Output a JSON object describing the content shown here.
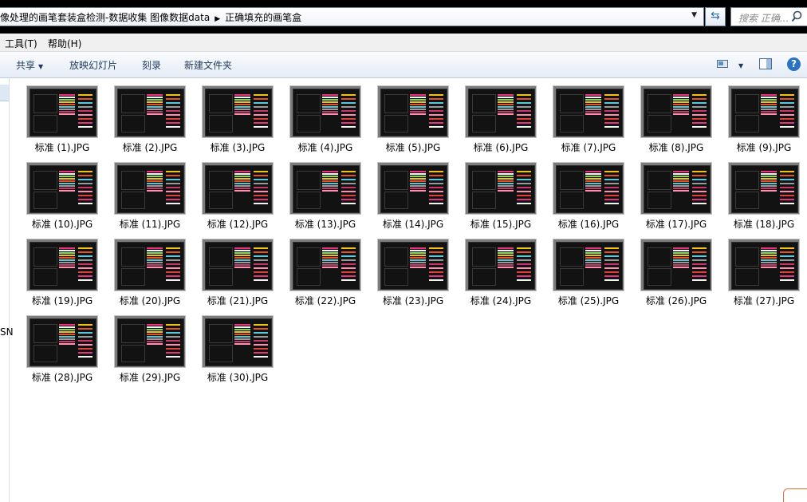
{
  "address": {
    "path_prefix": "像处理的画笔套装盒检测-数据收集 图像数据data",
    "path_current": "正确填充的画笔盒"
  },
  "search": {
    "placeholder": "搜索 正确..."
  },
  "menu": {
    "tools": "工具(T)",
    "help": "帮助(H)"
  },
  "toolbar": {
    "share": "共享",
    "slideshow": "放映幻灯片",
    "burn": "刻录",
    "new_folder": "新建文件夹",
    "help_label": "?"
  },
  "nav": {
    "clipped_text": "SN"
  },
  "colors": {
    "accent": "#2b73c2",
    "cmd_text": "#1e395b"
  },
  "files": [
    "标准 (1).JPG",
    "标准 (2).JPG",
    "标准 (3).JPG",
    "标准 (4).JPG",
    "标准 (5).JPG",
    "标准 (6).JPG",
    "标准 (7).JPG",
    "标准 (8).JPG",
    "标准 (9).JPG",
    "标准 (10).JPG",
    "标准 (11).JPG",
    "标准 (12).JPG",
    "标准 (13).JPG",
    "标准 (14).JPG",
    "标准 (15).JPG",
    "标准 (16).JPG",
    "标准 (17).JPG",
    "标准 (18).JPG",
    "标准 (19).JPG",
    "标准 (20).JPG",
    "标准 (21).JPG",
    "标准 (22).JPG",
    "标准 (23).JPG",
    "标准 (24).JPG",
    "标准 (25).JPG",
    "标准 (26).JPG",
    "标准 (27).JPG",
    "标准 (28).JPG",
    "标准 (29).JPG",
    "标准 (30).JPG"
  ]
}
